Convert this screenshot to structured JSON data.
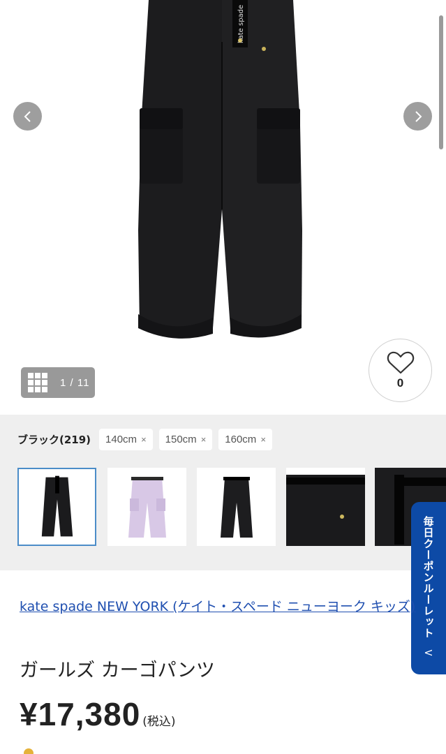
{
  "gallery": {
    "prev_icon": "chevron-left-icon",
    "next_icon": "chevron-right-icon",
    "counter_icon": "grid-icon",
    "counter_text": "1 / 11",
    "favorite_icon": "heart-icon",
    "favorite_count": "0"
  },
  "variants": {
    "color_label": "ブラック(219)",
    "sizes": [
      {
        "label": "140cm",
        "remove": "×"
      },
      {
        "label": "150cm",
        "remove": "×"
      },
      {
        "label": "160cm",
        "remove": "×"
      }
    ],
    "thumbnails": [
      {
        "color": "black",
        "selected": true
      },
      {
        "color": "lavender",
        "selected": false
      },
      {
        "color": "black",
        "selected": false
      },
      {
        "color": "black-waist",
        "selected": false
      },
      {
        "color": "black-belt",
        "selected": false
      }
    ]
  },
  "coupon": {
    "label": "毎日クーポンルーレット",
    "chevron": "<"
  },
  "product": {
    "brand": "kate spade NEW YORK (ケイト・スペード ニューヨーク キッズ)",
    "title": "ガールズ カーゴパンツ",
    "price": "¥17,380",
    "tax_note": "(税込)"
  },
  "colors": {
    "accent_blue": "#0d4aa6",
    "link_blue": "#1f4fb0",
    "selected_border": "#4b8cc8"
  }
}
